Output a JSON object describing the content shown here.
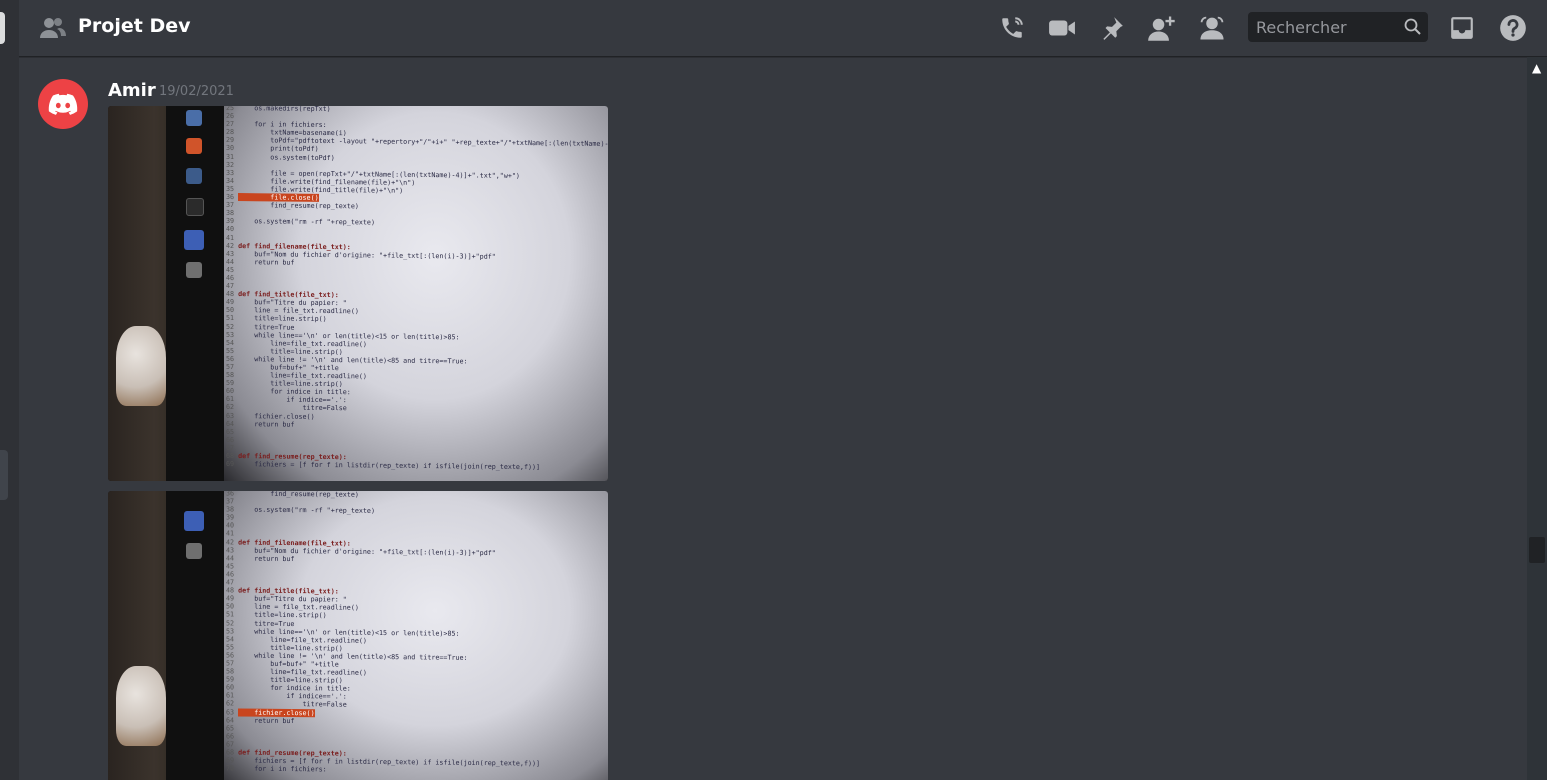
{
  "channel": {
    "title": "Projet Dev"
  },
  "toolbar": {
    "icons": [
      "start-voice-call-icon",
      "start-video-call-icon",
      "pinned-messages-icon",
      "add-friends-to-dm-icon",
      "member-list-icon",
      "inbox-icon",
      "help-icon"
    ],
    "search_placeholder": "Rechercher"
  },
  "message": {
    "author": "Amir",
    "timestamp": "19/02/2021",
    "avatar_color": "#ed4245",
    "attachments": [
      {
        "lines": [
          {
            "n": "25",
            "t": "    os.makedirs(repTxt)"
          },
          {
            "n": "26",
            "t": ""
          },
          {
            "n": "27",
            "t": "    for i in fichiers:"
          },
          {
            "n": "28",
            "t": "        txtName=basename(i)"
          },
          {
            "n": "29",
            "t": "        toPdf=\"pdftotext -layout \"+repertory+\"/\"+i+\" \"+rep_texte+\"/\"+txtName[:(len(txtName)-4)]"
          },
          {
            "n": "30",
            "t": "        print(toPdf)"
          },
          {
            "n": "31",
            "t": "        os.system(toPdf)"
          },
          {
            "n": "32",
            "t": ""
          },
          {
            "n": "33",
            "t": "        file = open(repTxt+\"/\"+txtName[:(len(txtName)-4)]+\".txt\",\"w+\")"
          },
          {
            "n": "34",
            "t": "        file.write(find_filename(file)+\"\\n\")"
          },
          {
            "n": "35",
            "t": "        file.write(find_title(file)+\"\\n\")"
          },
          {
            "n": "36",
            "t": "        file.close()",
            "hl": true
          },
          {
            "n": "37",
            "t": "        find_resume(rep_texte)"
          },
          {
            "n": "38",
            "t": ""
          },
          {
            "n": "39",
            "t": "    os.system(\"rm -rf \"+rep_texte)"
          },
          {
            "n": "40",
            "t": ""
          },
          {
            "n": "41",
            "t": ""
          },
          {
            "n": "42",
            "t": "def find_filename(file_txt):"
          },
          {
            "n": "43",
            "t": "    buf=\"Nom du fichier d'origine: \"+file_txt[:(len(i)-3)]+\"pdf\""
          },
          {
            "n": "44",
            "t": "    return buf"
          },
          {
            "n": "45",
            "t": ""
          },
          {
            "n": "46",
            "t": ""
          },
          {
            "n": "47",
            "t": ""
          },
          {
            "n": "48",
            "t": "def find_title(file_txt):"
          },
          {
            "n": "49",
            "t": "    buf=\"Titre du papier: \""
          },
          {
            "n": "50",
            "t": "    line = file_txt.readline()"
          },
          {
            "n": "51",
            "t": "    title=line.strip()"
          },
          {
            "n": "52",
            "t": "    titre=True"
          },
          {
            "n": "53",
            "t": "    while line=='\\n' or len(title)<15 or len(title)>85:"
          },
          {
            "n": "54",
            "t": "        line=file_txt.readline()"
          },
          {
            "n": "55",
            "t": "        title=line.strip()"
          },
          {
            "n": "56",
            "t": "    while line != '\\n' and len(title)<85 and titre==True:"
          },
          {
            "n": "57",
            "t": "        buf=buf+\" \"+title"
          },
          {
            "n": "58",
            "t": "        line=file_txt.readline()"
          },
          {
            "n": "59",
            "t": "        title=line.strip()"
          },
          {
            "n": "60",
            "t": "        for indice in title:"
          },
          {
            "n": "61",
            "t": "            if indice=='.':"
          },
          {
            "n": "62",
            "t": "                titre=False"
          },
          {
            "n": "63",
            "t": "    fichier.close()"
          },
          {
            "n": "64",
            "t": "    return buf"
          },
          {
            "n": "65",
            "t": ""
          },
          {
            "n": "66",
            "t": ""
          },
          {
            "n": "67",
            "t": ""
          },
          {
            "n": "68",
            "t": "def find_resume(rep_texte):"
          },
          {
            "n": "69",
            "t": "    fichiers = [f for f in listdir(rep_texte) if isfile(join(rep_texte,f))]"
          }
        ]
      },
      {
        "lines": [
          {
            "n": "36",
            "t": "        find_resume(rep_texte)"
          },
          {
            "n": "37",
            "t": ""
          },
          {
            "n": "38",
            "t": "    os.system(\"rm -rf \"+rep_texte)"
          },
          {
            "n": "39",
            "t": ""
          },
          {
            "n": "40",
            "t": ""
          },
          {
            "n": "41",
            "t": ""
          },
          {
            "n": "42",
            "t": "def find_filename(file_txt):"
          },
          {
            "n": "43",
            "t": "    buf=\"Nom du fichier d'origine: \"+file_txt[:(len(i)-3)]+\"pdf\""
          },
          {
            "n": "44",
            "t": "    return buf"
          },
          {
            "n": "45",
            "t": ""
          },
          {
            "n": "46",
            "t": ""
          },
          {
            "n": "47",
            "t": ""
          },
          {
            "n": "48",
            "t": "def find_title(file_txt):"
          },
          {
            "n": "49",
            "t": "    buf=\"Titre du papier: \""
          },
          {
            "n": "50",
            "t": "    line = file_txt.readline()"
          },
          {
            "n": "51",
            "t": "    title=line.strip()"
          },
          {
            "n": "52",
            "t": "    titre=True"
          },
          {
            "n": "53",
            "t": "    while line=='\\n' or len(title)<15 or len(title)>85:"
          },
          {
            "n": "54",
            "t": "        line=file_txt.readline()"
          },
          {
            "n": "55",
            "t": "        title=line.strip()"
          },
          {
            "n": "56",
            "t": "    while line != '\\n' and len(title)<85 and titre==True:"
          },
          {
            "n": "57",
            "t": "        buf=buf+\" \"+title"
          },
          {
            "n": "58",
            "t": "        line=file_txt.readline()"
          },
          {
            "n": "59",
            "t": "        title=line.strip()"
          },
          {
            "n": "60",
            "t": "        for indice in title:"
          },
          {
            "n": "61",
            "t": "            if indice=='.':"
          },
          {
            "n": "62",
            "t": "                titre=False"
          },
          {
            "n": "63",
            "t": "    fichier.close()",
            "hl": true
          },
          {
            "n": "64",
            "t": "    return buf"
          },
          {
            "n": "65",
            "t": ""
          },
          {
            "n": "66",
            "t": ""
          },
          {
            "n": "67",
            "t": ""
          },
          {
            "n": "68",
            "t": "def find_resume(rep_texte):"
          },
          {
            "n": "69",
            "t": "    fichiers = [f for f in listdir(rep_texte) if isfile(join(rep_texte,f))]"
          },
          {
            "n": "70",
            "t": "    for i in fichiers:"
          }
        ]
      }
    ]
  }
}
